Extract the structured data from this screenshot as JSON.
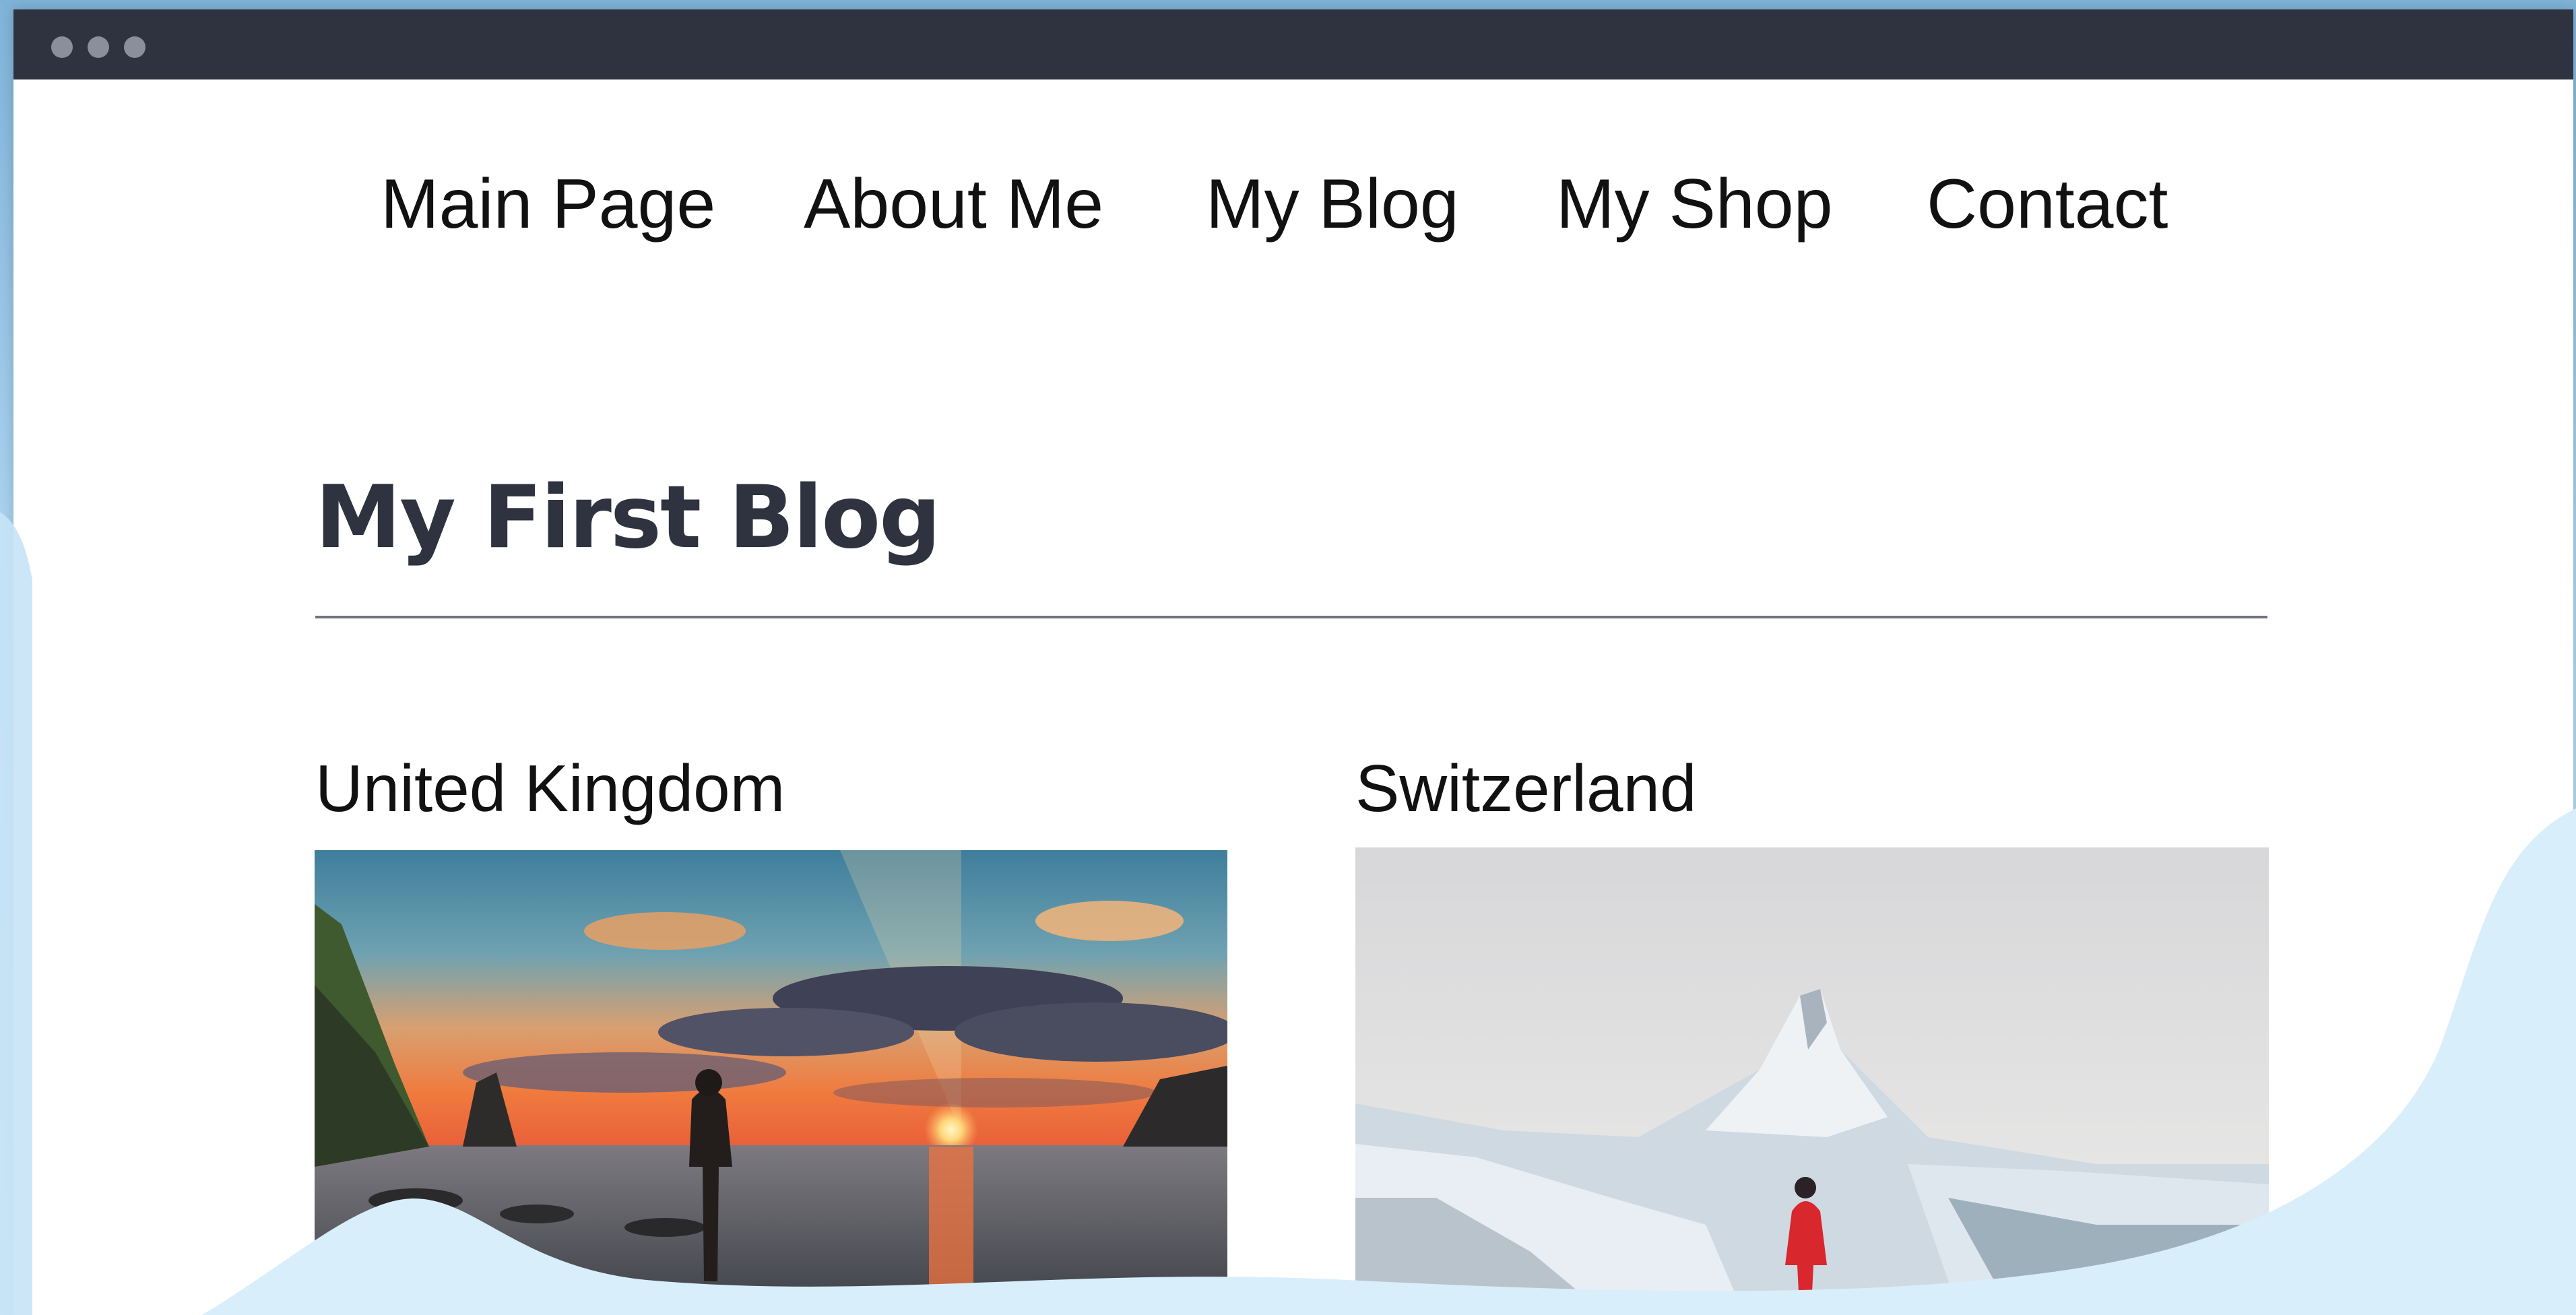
{
  "nav": {
    "items": [
      {
        "label": "Main Page"
      },
      {
        "label": "About Me"
      },
      {
        "label": "My Blog"
      },
      {
        "label": "My Shop"
      },
      {
        "label": "Contact"
      }
    ]
  },
  "blog": {
    "title": "My First Blog",
    "posts": [
      {
        "title": "United Kingdom"
      },
      {
        "title": "Switzerland"
      }
    ]
  },
  "colors": {
    "titlebar": "#2f3340",
    "heading": "#2f3340",
    "text": "#111111",
    "wave": "#d9eefb"
  }
}
